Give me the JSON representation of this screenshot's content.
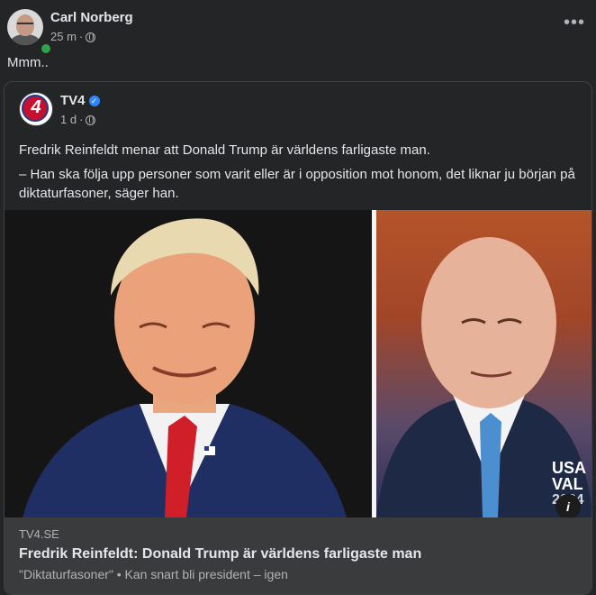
{
  "post": {
    "author": "Carl Norberg",
    "time": "25 m",
    "separator": "·",
    "text": "Mmm..",
    "more_icon": "ellipsis-icon",
    "more_label": "•••"
  },
  "shared": {
    "author": "TV4",
    "logo_text": "4",
    "verified": "✓",
    "time": "1 d",
    "separator": "·",
    "paragraphs": [
      "Fredrik Reinfeldt menar att Donald Trump är världens farligaste man.",
      "– Han ska följa upp personer som varit eller är i opposition mot honom, det liknar ju början på diktaturfasoner, säger han."
    ]
  },
  "link": {
    "badge_line1": "USA",
    "badge_line2": "VAL",
    "badge_year": "2024",
    "info_label": "i",
    "domain": "TV4.SE",
    "title": "Fredrik Reinfeldt: Donald Trump är världens farligaste man",
    "subtitle": "\"Diktaturfasoner\" • Kan snart bli president – igen"
  },
  "colors": {
    "background": "#242526",
    "footer": "#3a3b3c",
    "verified": "#2d88ff",
    "online": "#31a24c"
  }
}
